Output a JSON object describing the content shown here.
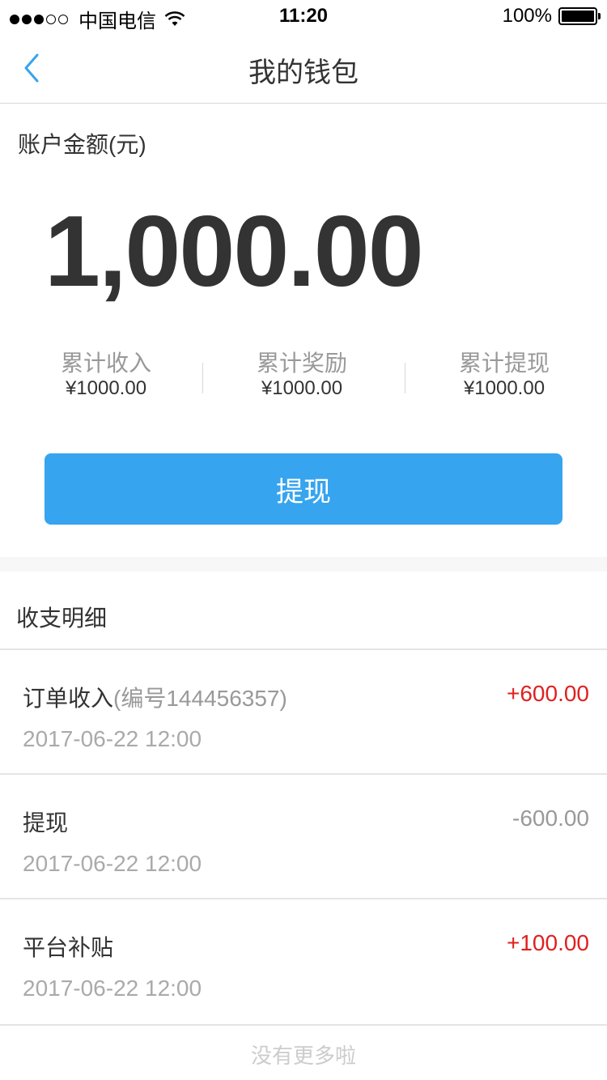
{
  "status_bar": {
    "carrier": "中国电信",
    "time": "11:20",
    "battery": "100%"
  },
  "nav": {
    "title": "我的钱包"
  },
  "account": {
    "label": "账户金额(元)",
    "balance": "1,000.00",
    "stats": [
      {
        "label": "累计收入",
        "value": "¥1000.00"
      },
      {
        "label": "累计奖励",
        "value": "¥1000.00"
      },
      {
        "label": "累计提现",
        "value": "¥1000.00"
      }
    ]
  },
  "withdraw_button": "提现",
  "details": {
    "header": "收支明细",
    "records": [
      {
        "title": "订单收入",
        "sub": "(编号144456357)",
        "amount": "+600.00",
        "date": "2017-06-22 12:00",
        "type": "pos"
      },
      {
        "title": "提现",
        "sub": "",
        "amount": "-600.00",
        "date": "2017-06-22 12:00",
        "type": "neg"
      },
      {
        "title": "平台补贴",
        "sub": "",
        "amount": "+100.00",
        "date": "2017-06-22 12:00",
        "type": "pos"
      }
    ],
    "no_more": "没有更多啦"
  },
  "colors": {
    "accent": "#36a4ef",
    "positive": "#e02020",
    "muted": "#999999"
  }
}
